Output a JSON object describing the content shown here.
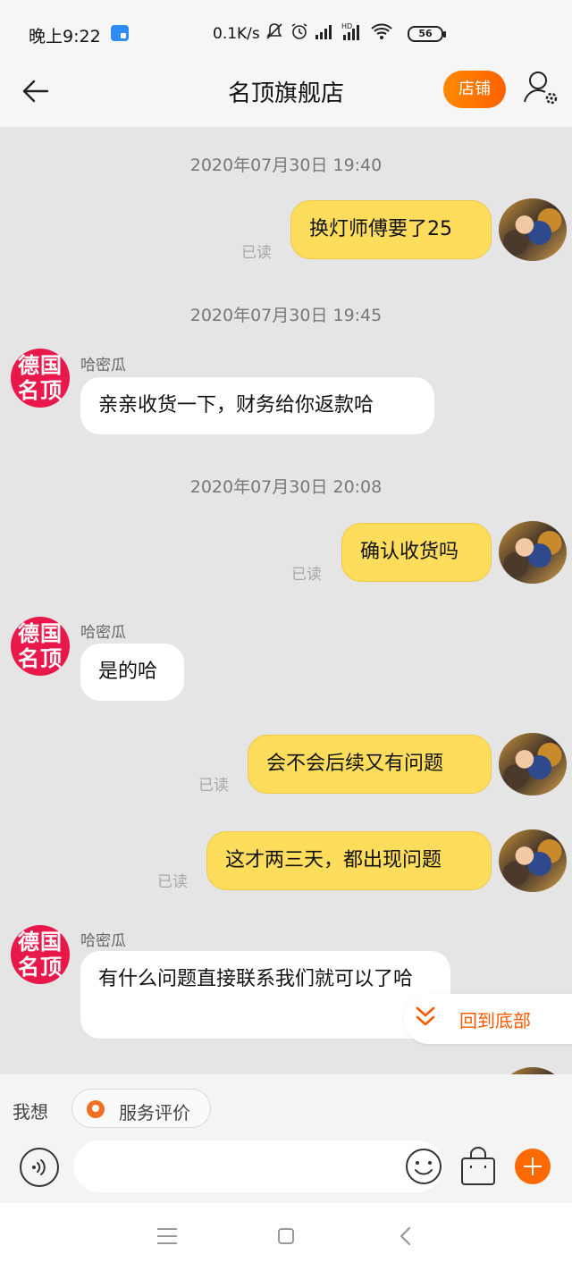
{
  "status_bar": {
    "time": "晚上9:22",
    "net_speed": "0.1K/s",
    "battery": "56",
    "icons": [
      "app-notification-icon",
      "mute-icon",
      "alarm-icon",
      "signal-icon",
      "hd-signal-icon",
      "wifi-icon",
      "battery-icon"
    ]
  },
  "header": {
    "title": "名顶旗舰店",
    "shop_label": "店铺",
    "back_icon": "back-arrow-icon",
    "profile_icon": "user-settings-icon"
  },
  "chat": {
    "self_avatar": "user-photo-avatar",
    "other_avatar_text": [
      "德国",
      "名顶"
    ],
    "other_name": "哈密瓜",
    "read_label": "已读",
    "timestamps": [
      "2020年07月30日 19:40",
      "2020年07月30日 19:45",
      "2020年07月30日 20:08"
    ],
    "messages": [
      {
        "from": "me",
        "text": "换灯师傅要了25",
        "read": true
      },
      {
        "from": "them",
        "name": "哈密瓜",
        "text": "亲亲收货一下，财务给你返款哈"
      },
      {
        "from": "me",
        "text": "确认收货吗",
        "read": true
      },
      {
        "from": "them",
        "name": "哈密瓜",
        "text": "是的哈"
      },
      {
        "from": "me",
        "text": "会不会后续又有问题",
        "read": true
      },
      {
        "from": "me",
        "text": "这才两三天，都出现问题",
        "read": true
      },
      {
        "from": "them",
        "name": "哈密瓜",
        "text": "有什么问题直接联系我们就可以了哈"
      }
    ],
    "back_to_bottom_label": "回到底部"
  },
  "quick_reply": {
    "label": "我想",
    "chip_label": "服务评价"
  },
  "input_bar": {
    "placeholder": "",
    "icons": [
      "voice-icon",
      "emoji-icon",
      "shopping-bag-icon",
      "plus-icon"
    ]
  },
  "colors": {
    "accent": "#ff6a00",
    "self_bubble": "#fedc5c",
    "other_bubble": "#ffffff",
    "brand_avatar": "#e8194a",
    "background": "#e5e5e5"
  }
}
